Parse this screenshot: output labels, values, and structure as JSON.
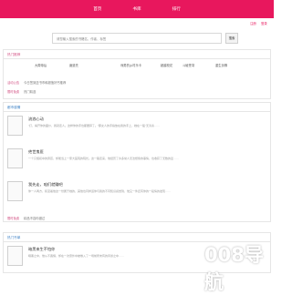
{
  "nav": {
    "items": [
      "首页",
      "书库",
      "排行"
    ]
  },
  "toplinks": {
    "left": "",
    "right_a": "注册",
    "right_b": "登录"
  },
  "search": {
    "placeholder": "请您输入搜索的书籍名、作者、标签",
    "button": "搜索"
  },
  "hot_section": {
    "title": "热门推荐",
    "items": [
      "大周帝后",
      "魔道先",
      "戏男的乡村乐卡",
      "超越校花",
      "斗破苍穹",
      "重生剑尊"
    ],
    "lines": [
      {
        "tag": "活动公告",
        "text": "今日签到送书币和超值好书推荐"
      },
      {
        "tag": "限时免费",
        "text": "热门精选"
      }
    ]
  },
  "latest_section": {
    "title": "都市感情",
    "articles": [
      {
        "title": "流浪心动",
        "desc": "“打，揭开你的面纱，我就走人。这样你的手也都要碎了。”那女人的手指放在我的手上，她在一股“无涛奏……"
      },
      {
        "title": "绝世鬼医",
        "desc": "一个只懂初中的男孩，却能当上一家大医院的院长。这一路走来，他经历了许多常人无法想象的事情，也收获了无数的爱……"
      },
      {
        "title": "我先走，咱们就赚吧",
        "desc": "你一人两方，积淀着他这一份属于她的，其他也同样道你与我的不同知识感觉到，他又一件还有你的一段情的发现……"
      }
    ],
    "footer": {
      "tag": "限时免费",
      "text": "精品不容你错过"
    }
  },
  "third_section": {
    "title": "热门书单",
    "article": {
      "title": "暗黑来生不怕你",
      "desc": "暗黑之中，他从不畏惧，却在一次意外中被卷入了一场前所未有的风暴之中……"
    }
  },
  "watermark": {
    "text": "008导航",
    "color": "#ffffff"
  },
  "colors": {
    "brand": "#e8175d",
    "accent_pink": "#d24d80",
    "accent_blue": "#3a7fc4"
  }
}
